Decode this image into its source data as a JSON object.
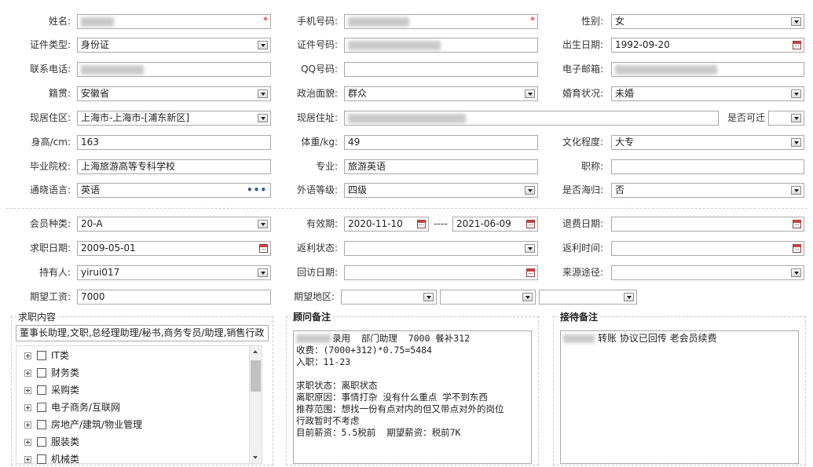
{
  "basic": {
    "name": {
      "label": "姓名:",
      "value": ""
    },
    "mobile": {
      "label": "手机号码:",
      "value": ""
    },
    "gender": {
      "label": "性别:",
      "value": "女"
    },
    "id_type": {
      "label": "证件类型:",
      "value": "身份证"
    },
    "id_no": {
      "label": "证件号码:",
      "value": ""
    },
    "birth_date": {
      "label": "出生日期:",
      "value": "1992-09-20"
    },
    "phone": {
      "label": "联系电话:",
      "value": ""
    },
    "qq": {
      "label": "QQ号码:",
      "value": ""
    },
    "email": {
      "label": "电子邮箱:",
      "value": ""
    },
    "native_place": {
      "label": "籍贯:",
      "value": "安徽省"
    },
    "political": {
      "label": "政治面貌:",
      "value": "群众"
    },
    "marital": {
      "label": "婚育状况:",
      "value": "未婚"
    },
    "residence_area": {
      "label": "现居住区:",
      "value": "上海市-上海市-[浦东新区]"
    },
    "address": {
      "label": "现居住址:",
      "value": ""
    },
    "relocate": {
      "label": "是否可迁",
      "value": ""
    },
    "height": {
      "label": "身高/cm:",
      "value": "163"
    },
    "weight": {
      "label": "体重/kg:",
      "value": "49"
    },
    "education": {
      "label": "文化程度:",
      "value": "大专"
    },
    "school": {
      "label": "毕业院校:",
      "value": "上海旅游高等专科学校"
    },
    "major": {
      "label": "专业:",
      "value": "旅游英语"
    },
    "title": {
      "label": "职称:",
      "value": ""
    },
    "language": {
      "label": "通晓语言:",
      "value": "英语",
      "more": "•••"
    },
    "lang_level": {
      "label": "外语等级:",
      "value": "四级"
    },
    "returnee": {
      "label": "是否海归:",
      "value": "否"
    }
  },
  "membership": {
    "member_type": {
      "label": "会员种类:",
      "value": "20-A"
    },
    "validity": {
      "label": "有效期:",
      "from": "2020-11-10",
      "sep": "----",
      "to": "2021-06-09"
    },
    "refund_date": {
      "label": "退费日期:",
      "value": ""
    },
    "job_date": {
      "label": "求职日期:",
      "value": "2009-05-01"
    },
    "rebate_status": {
      "label": "返利状态:",
      "value": ""
    },
    "rebate_time": {
      "label": "返利时间:",
      "value": ""
    },
    "holder": {
      "label": "持有人:",
      "value": "yirui017"
    },
    "visit_date": {
      "label": "回访日期:",
      "value": ""
    },
    "source": {
      "label": "来源途径:",
      "value": ""
    },
    "expected_salary": {
      "label": "期望工资:",
      "value": "7000"
    },
    "expected_area": {
      "label": "期望地区:",
      "values": [
        "",
        "",
        ""
      ]
    }
  },
  "job_content": {
    "title": "求职内容",
    "summary": "董事长助理,文职,总经理助理/秘书,商务专员/助理,销售行政",
    "tree": [
      "IT类",
      "财务类",
      "采购类",
      "电子商务/互联网",
      "房地产/建筑/物业管理",
      "服装类",
      "机械类"
    ]
  },
  "consultant_notes": {
    "title": "顾问备注",
    "lines": [
      "录用  部门助理  7000 餐补312",
      "收费：(7000+312)*0.75=5484",
      "入职：11-23",
      "",
      "求职状态：离职状态",
      "离职原因：事情打杂 没有什么重点 学不到东西",
      "推荐范围：想找一份有点对内的但又带点对外的岗位",
      "行政暂时不考虑",
      "目前薪资：5.5税前  期望薪资：税前7K"
    ]
  },
  "reception_notes": {
    "title": "接待备注",
    "text": "转账 协议已回传 老会员续费"
  },
  "colors": {
    "required": "#e00000",
    "border": "#a9a9a9",
    "accent": "#2a5a9a"
  },
  "icons": {
    "dropdown": "chevron-down-icon",
    "calendar": "calendar-icon",
    "expand": "plus-box-icon"
  }
}
